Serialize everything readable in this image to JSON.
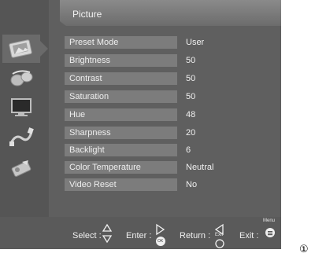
{
  "title": "Picture",
  "categories": [
    {
      "icon": "picture-settings-icon",
      "active": true
    },
    {
      "icon": "audio-settings-icon",
      "active": false
    },
    {
      "icon": "screen-settings-icon",
      "active": false
    },
    {
      "icon": "connection-settings-icon",
      "active": false
    },
    {
      "icon": "tools-settings-icon",
      "active": false
    }
  ],
  "items": [
    {
      "label": "Preset Mode",
      "value": "User"
    },
    {
      "label": "Brightness",
      "value": "50"
    },
    {
      "label": "Contrast",
      "value": "50"
    },
    {
      "label": "Saturation",
      "value": "50"
    },
    {
      "label": "Hue",
      "value": "48"
    },
    {
      "label": "Sharpness",
      "value": "20"
    },
    {
      "label": "Backlight",
      "value": "6"
    },
    {
      "label": "Color Temperature",
      "value": "Neutral"
    },
    {
      "label": "Video Reset",
      "value": "No"
    }
  ],
  "footer": {
    "select_label": "Select :",
    "enter_label": "Enter :",
    "enter_key": "OK",
    "return_label": "Return :",
    "return_key": "Exit",
    "exit_label": "Exit :",
    "exit_key": "Menu"
  },
  "figure_marker": "①"
}
